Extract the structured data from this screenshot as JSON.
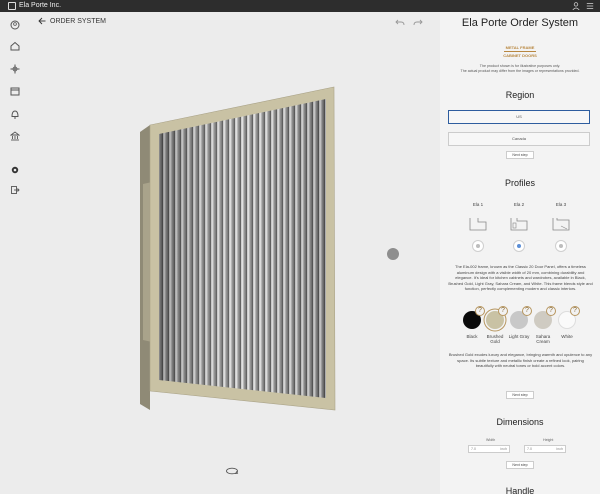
{
  "app": {
    "title": "Ela Porte Inc."
  },
  "viewport": {
    "back_label": "ORDER SYSTEM"
  },
  "panel": {
    "title": "Ela Porte Order System",
    "brand_line1": "METAL FRAME",
    "brand_line2": "CABINET DOORS",
    "disclaimer_line1": "The product shown is for illustrative purposes only.",
    "disclaimer_line2": "The actual product may differ from the images or representations provided.",
    "region": {
      "title": "Region",
      "options": [
        "US",
        "Canada"
      ],
      "selected": "US",
      "next_label": "Next step"
    },
    "profiles": {
      "title": "Profiles",
      "items": [
        {
          "label": "Ela 1",
          "selected": false
        },
        {
          "label": "Ela 2",
          "selected": true
        },
        {
          "label": "Ela 3",
          "selected": false
        }
      ],
      "description": "The Ela-002 frame, known as the Classic 20 Door Panel, offers a timeless aluminum design with a visible width of 20 mm, combining durability and elegance. It's ideal for kitchen cabinets and wardrobes, available in Black, Brushed Gold, Light Gray, Sahara Cream, and White. This frame blends style and function, perfectly complementing modern and classic interiors."
    },
    "colors": {
      "items": [
        {
          "label": "Black",
          "hex": "#0a0a0a",
          "selected": false
        },
        {
          "label": "Brushed Gold",
          "hex": "#c9c2a4",
          "selected": true
        },
        {
          "label": "Light Gray",
          "hex": "#c8c8c8",
          "selected": false
        },
        {
          "label": "Sahara Cream",
          "hex": "#cfcbc2",
          "selected": false
        },
        {
          "label": "White",
          "hex": "#fafafa",
          "selected": false
        }
      ],
      "description": "Brushed Gold exudes luxury and elegance, bringing warmth and opulence to any space. Its subtle texture and metallic finish create a refined look, pairing beautifully with neutral tones or bold accent colors.",
      "next_label": "Next step"
    },
    "dimensions": {
      "title": "Dimensions",
      "width_label": "Width",
      "height_label": "Height",
      "width_value": "7.0",
      "height_value": "7.0",
      "unit": "inch",
      "next_label": "Next step"
    },
    "handle": {
      "title": "Handle"
    }
  },
  "colors": {
    "accent": "#2e5d9f",
    "brand_gold": "#b88740",
    "titlebar": "#2d2d2d",
    "frame": "#c9c2a4"
  }
}
